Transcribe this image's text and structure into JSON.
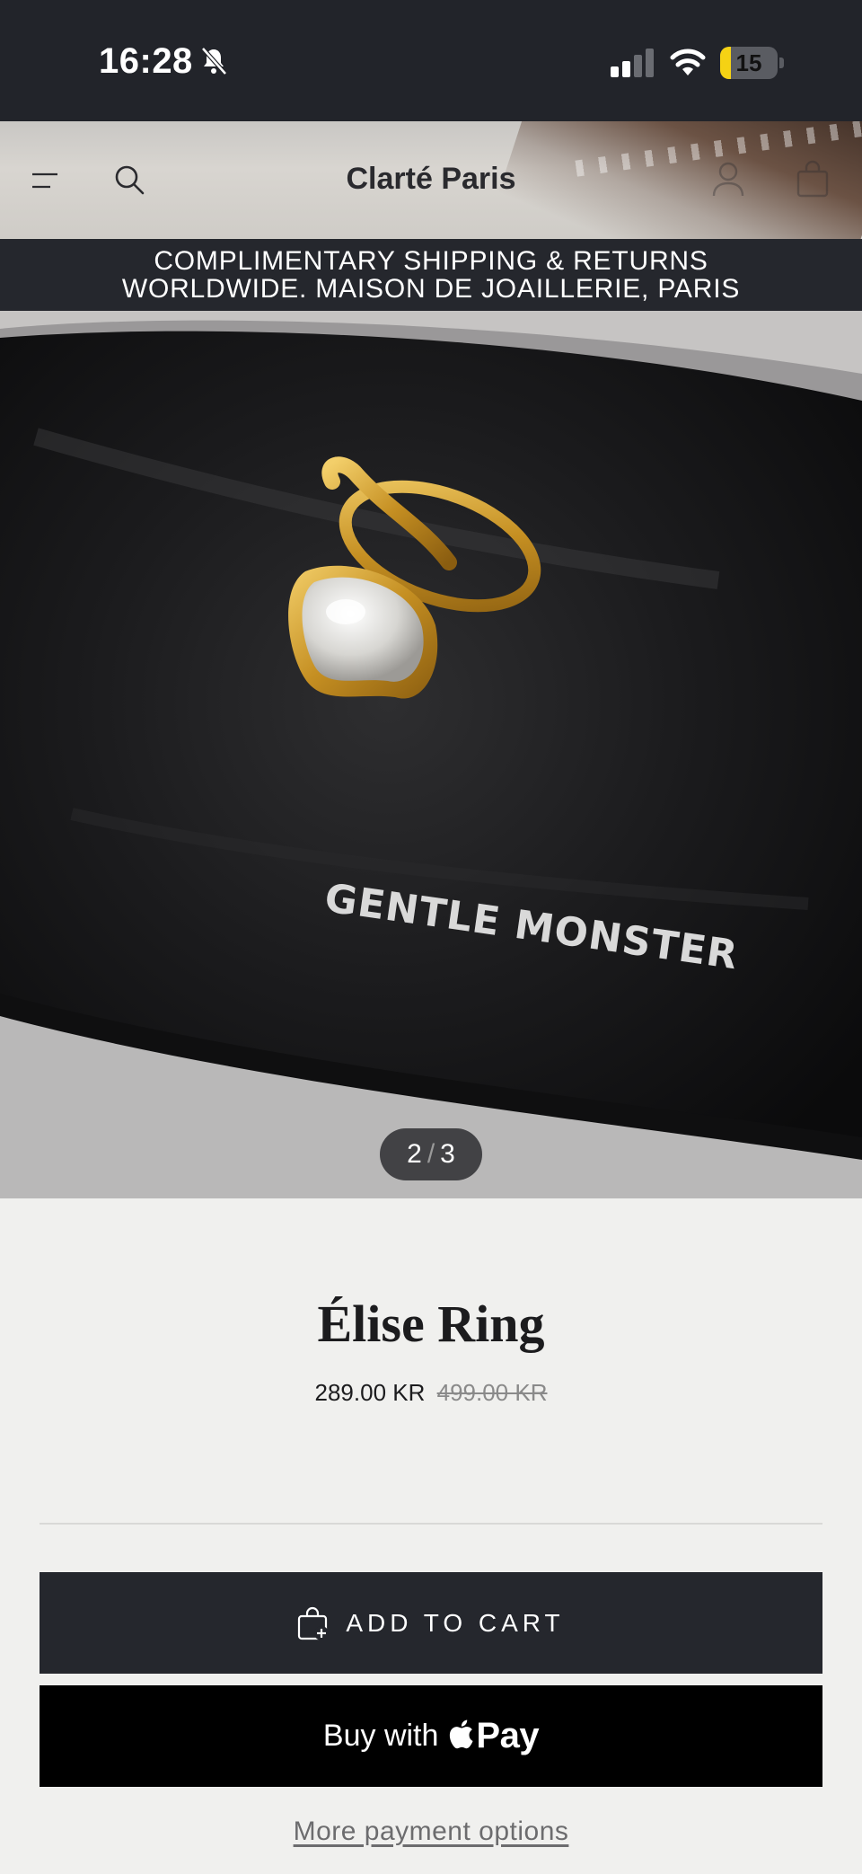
{
  "status_bar": {
    "time": "16:28",
    "battery_level": "15",
    "battery_fraction": 0.15,
    "icons": [
      "bell-slash-icon",
      "cellular-signal-icon",
      "wifi-icon",
      "battery-icon"
    ]
  },
  "header": {
    "brand": "Clarté Paris",
    "icons": [
      "menu-icon",
      "search-icon",
      "account-icon",
      "cart-icon"
    ]
  },
  "announcement": {
    "line1": "COMPLIMENTARY SHIPPING & RETURNS",
    "line2": "WORLDWIDE. MAISON DE JOAILLERIE, PARIS"
  },
  "gallery": {
    "pouch_print": "GENTLE MONSTER",
    "current": "2",
    "separator": "/",
    "total": "3"
  },
  "product": {
    "title": "Élise Ring",
    "price": "289.00 KR",
    "compare_at_price": "499.00 KR"
  },
  "actions": {
    "add_to_cart": "ADD TO CART",
    "buy_with": "Buy with",
    "pay_brand": "Pay",
    "more_payment_options": "More payment options"
  },
  "colors": {
    "dark": "#25272d",
    "background": "#f0f0ee",
    "battery_low": "#f5d214"
  }
}
